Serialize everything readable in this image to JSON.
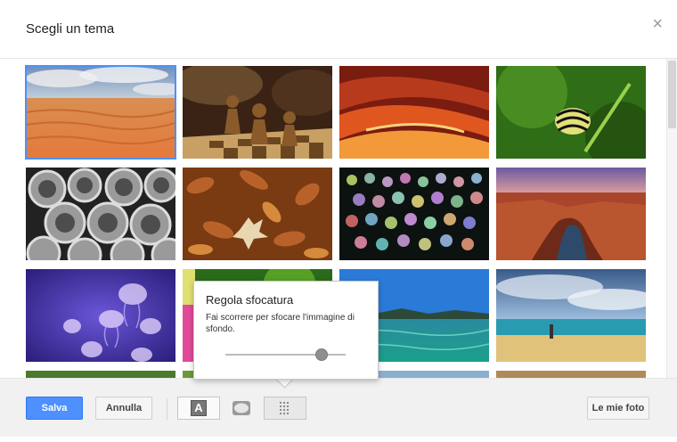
{
  "dialog": {
    "title": "Scegli un tema",
    "close_symbol": "×"
  },
  "themes": [
    {
      "name": "desert",
      "selected": true
    },
    {
      "name": "chess"
    },
    {
      "name": "canyon-red"
    },
    {
      "name": "caterpillar"
    },
    {
      "name": "pipes"
    },
    {
      "name": "leaves"
    },
    {
      "name": "bokeh"
    },
    {
      "name": "canyon-river"
    },
    {
      "name": "jellyfish"
    },
    {
      "name": "green-abstract"
    },
    {
      "name": "lake"
    },
    {
      "name": "beach"
    }
  ],
  "footer": {
    "save_label": "Salva",
    "cancel_label": "Annulla",
    "text_tool_glyph": "A",
    "my_photos_label": "Le mie foto"
  },
  "blur_popup": {
    "title": "Regola sfocatura",
    "description": "Fai scorrere per sfocare l'immagine di sfondo.",
    "level": 0.8
  },
  "colors": {
    "accent": "#4d90fe",
    "accent_border": "#3079ed"
  },
  "icons": [
    "close-icon",
    "text-icon",
    "vignette-icon",
    "blur-icon"
  ]
}
